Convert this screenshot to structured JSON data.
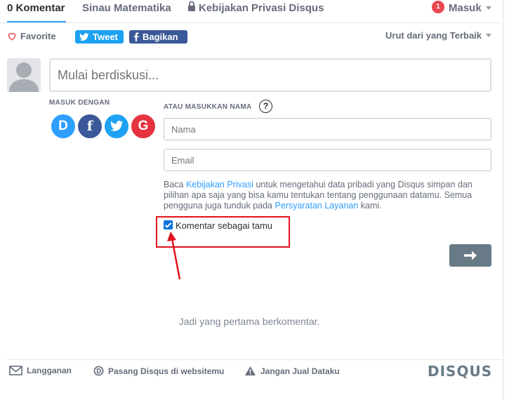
{
  "nav": {
    "tabs": [
      {
        "label": "0 Komentar"
      },
      {
        "label": "Sinau Matematika"
      },
      {
        "label": "Kebijakan Privasi Disqus"
      }
    ],
    "notification_count": "1",
    "login_label": "Masuk"
  },
  "actions": {
    "favorite_label": "Favorite",
    "tweet_label": "Tweet",
    "share_label": "Bagikan",
    "sort_label": "Urut dari yang Terbaik"
  },
  "composer": {
    "placeholder": "Mulai berdiskusi...",
    "login_with_label": "MASUK DENGAN",
    "or_name_label": "ATAU MASUKKAN NAMA",
    "help_glyph": "?",
    "name_placeholder": "Nama",
    "email_placeholder": "Email",
    "social": [
      {
        "name": "disqus",
        "glyph": "D",
        "color": "#2e9fff"
      },
      {
        "name": "facebook",
        "glyph": "f",
        "color": "#3b5998"
      },
      {
        "name": "twitter",
        "glyph": "t",
        "color": "#1da1f2"
      },
      {
        "name": "google",
        "glyph": "G",
        "color": "#dd4b39"
      }
    ],
    "policy_before": "Baca ",
    "policy_link": "Kebijakan Privasi",
    "policy_middle": " untuk mengetahui data pribadi yang Disqus simpan dan pilihan apa saja yang bisa kamu tentukan tentang penggunaan datamu. Semua pengguna juga tunduk pada ",
    "terms_link": "Persyaratan Layanan",
    "policy_after": " kami.",
    "guest_checkbox_label": "Komentar sebagai tamu",
    "guest_checked": true,
    "submit_icon": "arrow-right-icon"
  },
  "empty_message": "Jadi yang pertama berkomentar.",
  "footer": {
    "subscribe_label": "Langganan",
    "install_label": "Pasang Disqus di websitemu",
    "dont_sell_label": "Jangan Jual Dataku",
    "logo_text": "DISQUS"
  },
  "colors": {
    "accent": "#2e9fff",
    "highlight": "#e0141e",
    "button": "#687a86"
  }
}
